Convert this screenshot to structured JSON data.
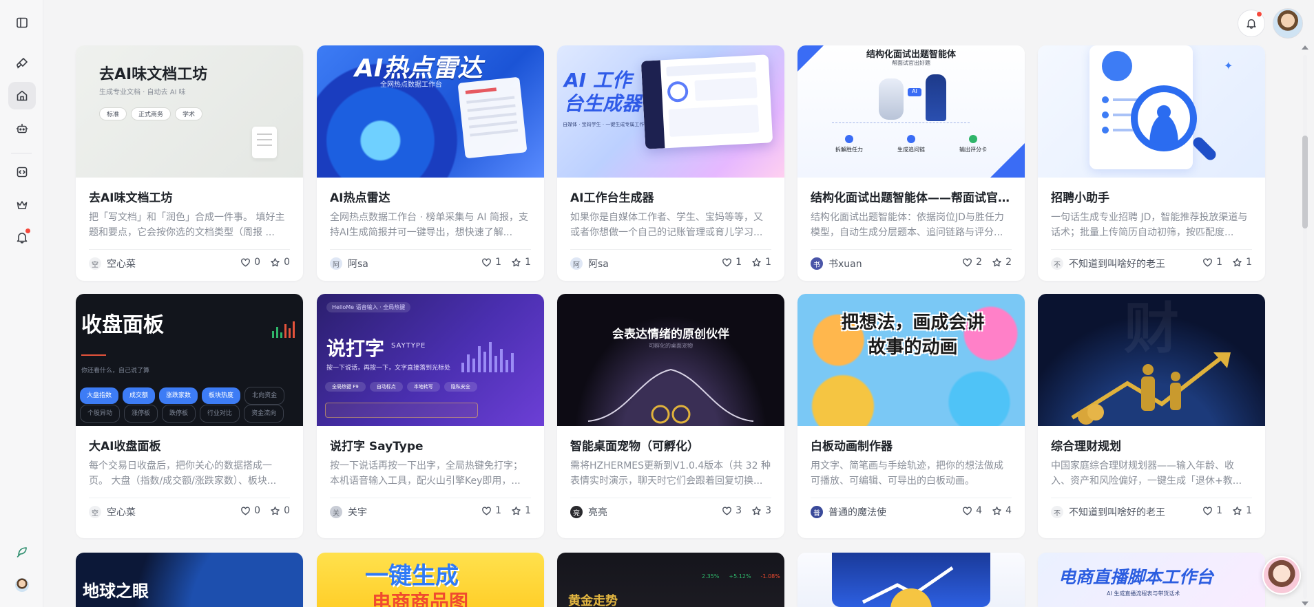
{
  "colors": {
    "accent": "#4b6bfb",
    "notification_dot": "#f5483b"
  },
  "sidebar": {
    "items": [
      {
        "icon": "sidebar-toggle-icon"
      },
      {
        "icon": "brush-icon"
      },
      {
        "icon": "home-icon"
      },
      {
        "icon": "robot-icon"
      },
      {
        "icon": "code-box-icon"
      },
      {
        "icon": "crown-icon"
      },
      {
        "icon": "bell-icon"
      },
      {
        "icon": "feather-logo-icon"
      },
      {
        "icon": "user-avatar-icon"
      }
    ]
  },
  "header": {
    "notification_icon": "bell-icon",
    "avatar_icon": "user-avatar-icon"
  },
  "cards": [
    {
      "thumb_title": "去AI味文档工坊",
      "thumb_sub": "生成专业文档 · 自动去 AI 味",
      "thumb_tags": [
        "标准",
        "正式商务",
        "学术"
      ],
      "title": "去AI味文档工坊",
      "desc": "把「写文档」和「润色」合成一件事。 填好主题和要点，它会按你选的文档类型（周报 ...",
      "author": "空心菜",
      "author_initial": "空",
      "likes": "0",
      "stars": "0"
    },
    {
      "thumb_title": "AI热点雷达",
      "thumb_sub": "全网热点数据工作台",
      "title": "AI热点雷达",
      "desc": "全网热点数据工作台 · 榜单采集与 AI 简报，支持AI生成简报并可一键导出，想快速了解...",
      "author": "阿sa",
      "author_initial": "阿",
      "likes": "1",
      "stars": "1"
    },
    {
      "thumb_title": "AI 工作台生成器",
      "thumb_sub": "自媒体 · 宝妈学生 · 一键生成专属工作台",
      "title": "AI工作台生成器",
      "desc": "如果你是自媒体工作者、学生、宝妈等等，又或者你想做一个自己的记账管理或育儿学习...",
      "author": "阿sa",
      "author_initial": "阿",
      "likes": "1",
      "stars": "1"
    },
    {
      "thumb_title": "结构化面试出题智能体",
      "thumb_sub": "帮面试官出好题",
      "thumb_steps": [
        "拆解胜任力",
        "生成追问链",
        "输出评分卡"
      ],
      "title": "结构化面试出题智能体——帮面试官出好题",
      "desc": "结构化面试出题智能体：依据岗位JD与胜任力模型，自动生成分层题本、追问链路与评分...",
      "author": "书xuan",
      "author_initial": "书",
      "likes": "2",
      "stars": "2"
    },
    {
      "title": "招聘小助手",
      "desc": "一句话生成专业招聘 JD，智能推荐投放渠道与话术；批量上传简历自动初筛，按匹配度...",
      "author": "不知道到叫啥好的老王",
      "author_initial": "不",
      "likes": "1",
      "stars": "1"
    },
    {
      "thumb_title": "收盘面板",
      "thumb_sub": "你还看什么，自己说了算",
      "thumb_tags": [
        "大盘指数",
        "成交额",
        "涨跌家数",
        "板块热度",
        "北向资金",
        "个股异动",
        "涨停板",
        "跌停板",
        "行业对比",
        "资金流向"
      ],
      "title": "大AI收盘面板",
      "desc": "每个交易日收盘后，把你关心的数据搭成一页。 大盘（指数/成交额/涨跌家数）、板块...",
      "author": "空心菜",
      "author_initial": "空",
      "likes": "0",
      "stars": "0"
    },
    {
      "thumb_title": "说打字",
      "thumb_title_en": "SAYTYPE",
      "thumb_top": "HelloMe 语音输入 · 全局热键",
      "thumb_sub": "按一下说话，再按一下，文字直接落到光标处",
      "thumb_tags": [
        "全局热键 F9",
        "自动标点",
        "本地转写",
        "隐私安全"
      ],
      "title": "说打字 SayType",
      "desc": "按一下说话再按一下出字，全局热键免打字；本机语音输入工具，配火山引擎Key即用，...",
      "author": "关宇",
      "author_initial": "关",
      "likes": "1",
      "stars": "1"
    },
    {
      "thumb_title": "会表达情绪的原创伙伴",
      "thumb_sub": "可孵化的桌面宠物",
      "title": "智能桌面宠物（可孵化）",
      "desc": "需将HZHERMES更新到V1.0.4版本（共 32 种表情实时演示，聊天时它们会跟着回复切换...",
      "author": "亮亮",
      "author_initial": "亮",
      "likes": "3",
      "stars": "3"
    },
    {
      "thumb_title": "把想法，画成会讲故事的动画",
      "title": "白板动画制作器",
      "desc": "用文字、简笔画与手绘轨迹，把你的想法做成可播放、可编辑、可导出的白板动画。",
      "author": "普通的魔法使",
      "author_initial": "普",
      "likes": "4",
      "stars": "4"
    },
    {
      "thumb_title": "财",
      "title": "综合理财规划",
      "desc": "中国家庭综合理财规划器——输入年龄、收入、资产和风险偏好，一键生成「退休+教...",
      "author": "不知道到叫啥好的老王",
      "author_initial": "不",
      "likes": "1",
      "stars": "1"
    },
    {
      "thumb_title": "地球之眼"
    },
    {
      "thumb_title": "一键生成",
      "thumb_sub": "电商商品图"
    },
    {
      "thumb_title": "黄金走势",
      "thumb_tags": [
        "2.35%",
        "+5.12%",
        "-1.08%"
      ]
    },
    {
      "thumb_title": ""
    },
    {
      "thumb_title": "电商直播脚本工作台",
      "thumb_sub": "AI 生成直播流程表与带货话术"
    }
  ]
}
